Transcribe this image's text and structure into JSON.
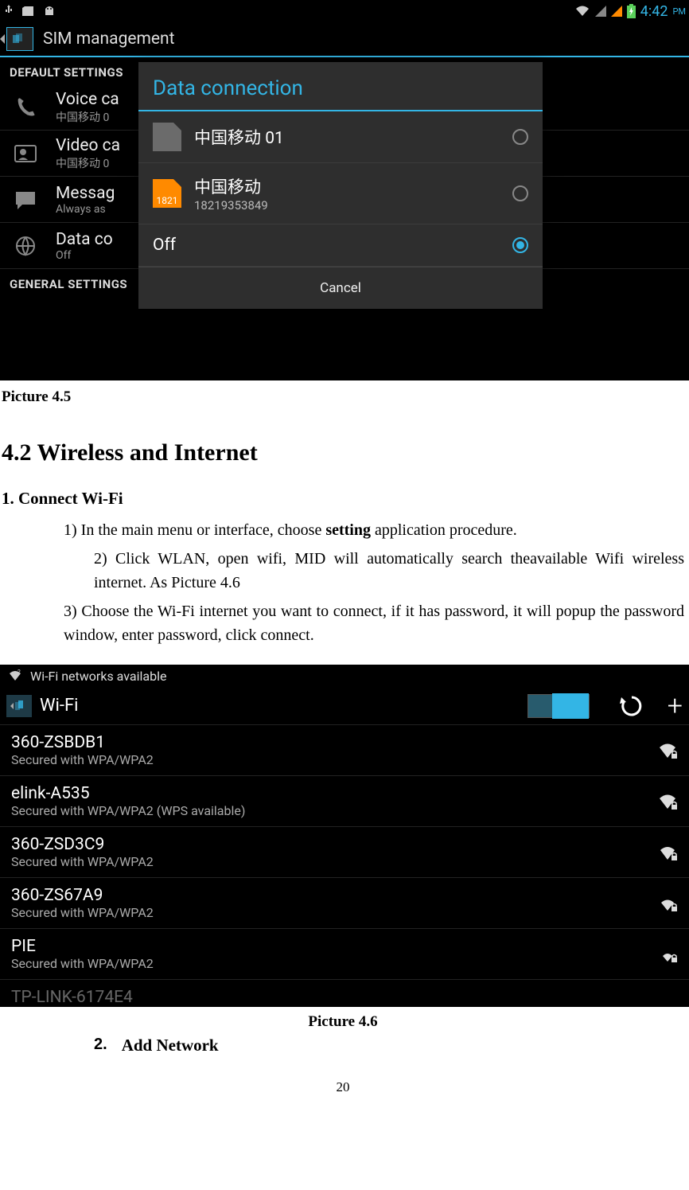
{
  "statusbar": {
    "time": "4:42",
    "ampm": "PM"
  },
  "shot1": {
    "title": "SIM management",
    "section1": "DEFAULT SETTINGS",
    "section2": "GENERAL SETTINGS",
    "rows": [
      {
        "title": "Voice ca",
        "sub": "中国移动 0"
      },
      {
        "title": "Video ca",
        "sub": "中国移动 0"
      },
      {
        "title": "Messag",
        "sub": "Always as"
      },
      {
        "title": "Data co",
        "sub": "Off"
      }
    ],
    "dialog": {
      "title": "Data connection",
      "opt1": "中国移动 01",
      "opt2a": "中国移动",
      "opt2b": "18219353849",
      "opt2badge": "1821",
      "opt3": "Off",
      "cancel": "Cancel"
    }
  },
  "doc": {
    "cap45": "Picture 4.5",
    "h2": "4.2 Wireless and Internet",
    "h3": "1. Connect Wi-Fi",
    "p1a": "1) In the main menu or interface, choose ",
    "p1b": "setting",
    "p1c": " application procedure.",
    "p2": "2)  Click  WLAN,  open  wifi,  MID  will  automatically  search  theavailable  Wifi wireless internet. As Picture 4.6",
    "p3": "3)    Choose the Wi-Fi internet you want to connect, if it has password, it will popup the password window, enter password, click connect.",
    "cap46": "Picture 4.6",
    "addnet_num": "2.",
    "addnet_txt": "Add Network",
    "pagenum": "20"
  },
  "shot2": {
    "notif": "Wi-Fi networks available",
    "title": "Wi-Fi",
    "nets": [
      {
        "ssid": "360-ZSBDB1",
        "sec": "Secured with WPA/WPA2"
      },
      {
        "ssid": "elink-A535",
        "sec": "Secured with WPA/WPA2 (WPS available)"
      },
      {
        "ssid": "360-ZSD3C9",
        "sec": "Secured with WPA/WPA2"
      },
      {
        "ssid": "360-ZS67A9",
        "sec": "Secured with WPA/WPA2"
      },
      {
        "ssid": "PIE",
        "sec": "Secured with WPA/WPA2"
      },
      {
        "ssid": "TP-LINK-6174E4",
        "sec": ""
      }
    ]
  }
}
